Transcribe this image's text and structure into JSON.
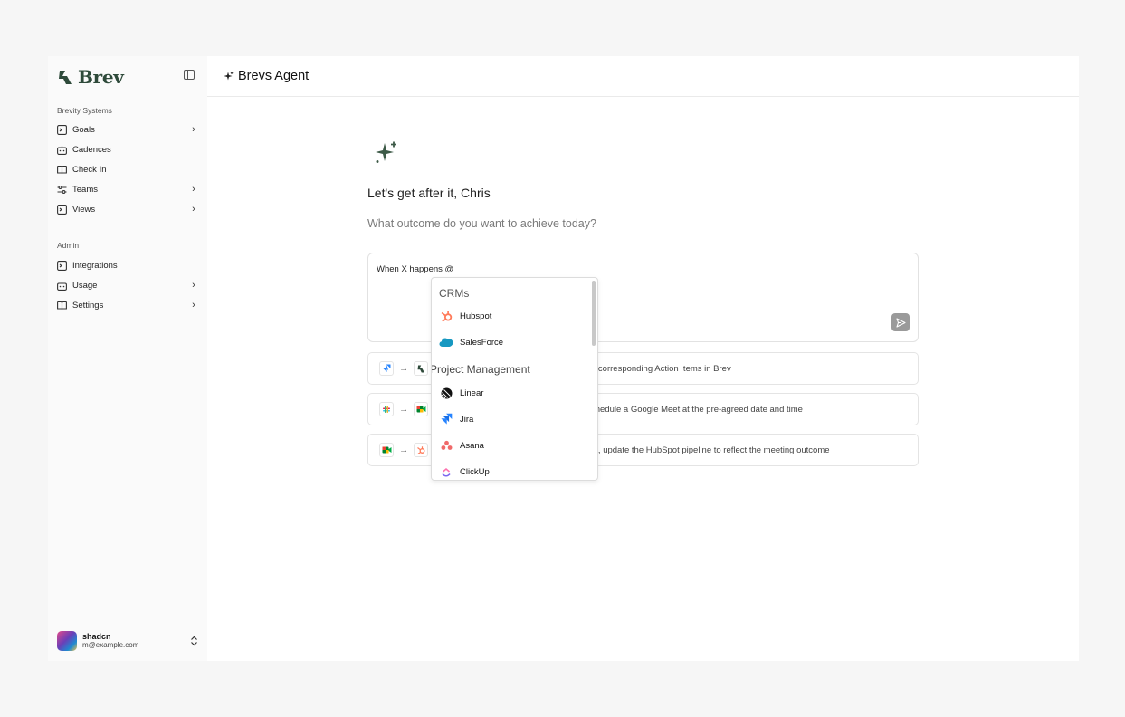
{
  "brand": {
    "name": "Brev",
    "color": "#2e4a3a"
  },
  "sidebar": {
    "workspace_label": "Brevity Systems",
    "main_items": [
      {
        "label": "Goals",
        "icon": "terminal-icon",
        "has_chevron": true
      },
      {
        "label": "Cadences",
        "icon": "bot-icon",
        "has_chevron": false
      },
      {
        "label": "Check In",
        "icon": "book-icon",
        "has_chevron": false
      },
      {
        "label": "Teams",
        "icon": "sliders-icon",
        "has_chevron": true
      },
      {
        "label": "Views",
        "icon": "terminal-icon",
        "has_chevron": true
      }
    ],
    "admin_label": "Admin",
    "admin_items": [
      {
        "label": "Integrations",
        "icon": "terminal-icon",
        "has_chevron": false
      },
      {
        "label": "Usage",
        "icon": "bot-icon",
        "has_chevron": true
      },
      {
        "label": "Settings",
        "icon": "book-icon",
        "has_chevron": true
      }
    ],
    "chevron": "›"
  },
  "user": {
    "name": "shadcn",
    "email": "m@example.com",
    "switch_glyph": "⌃⌄"
  },
  "header": {
    "title": "Brevs Agent"
  },
  "hero": {
    "greeting": "Let's get after it, Chris",
    "prompt": "What outcome do you want to achieve today?"
  },
  "composer": {
    "value": "When X happens @"
  },
  "suggestions": [
    {
      "from_icon": "jira-icon",
      "to_icon": "brev-icon",
      "text": "e corresponding Action Items in Brev"
    },
    {
      "from_icon": "slack-icon",
      "to_icon": "google-meet-icon",
      "text": "chedule a Google Meet at the pre-agreed date and time"
    },
    {
      "from_icon": "google-meet-icon",
      "to_icon": "hubspot-icon",
      "text": "et, update the HubSpot pipeline to reflect the meeting outcome"
    }
  ],
  "dropdown": {
    "groups": [
      {
        "label": "CRMs",
        "items": [
          {
            "label": "Hubspot",
            "icon": "hubspot-icon"
          },
          {
            "label": "SalesForce",
            "icon": "salesforce-icon"
          }
        ]
      },
      {
        "label": "Project Management",
        "items": [
          {
            "label": "Linear",
            "icon": "linear-icon"
          },
          {
            "label": "Jira",
            "icon": "jira-icon"
          },
          {
            "label": "Asana",
            "icon": "asana-icon"
          },
          {
            "label": "ClickUp",
            "icon": "clickup-icon"
          }
        ]
      }
    ]
  },
  "colors": {
    "hubspot": "#ff7a59",
    "salesforce": "#1798c1",
    "jira": "#2684ff",
    "asana": "#f06a6a",
    "send_button": "#9a9a9a"
  }
}
